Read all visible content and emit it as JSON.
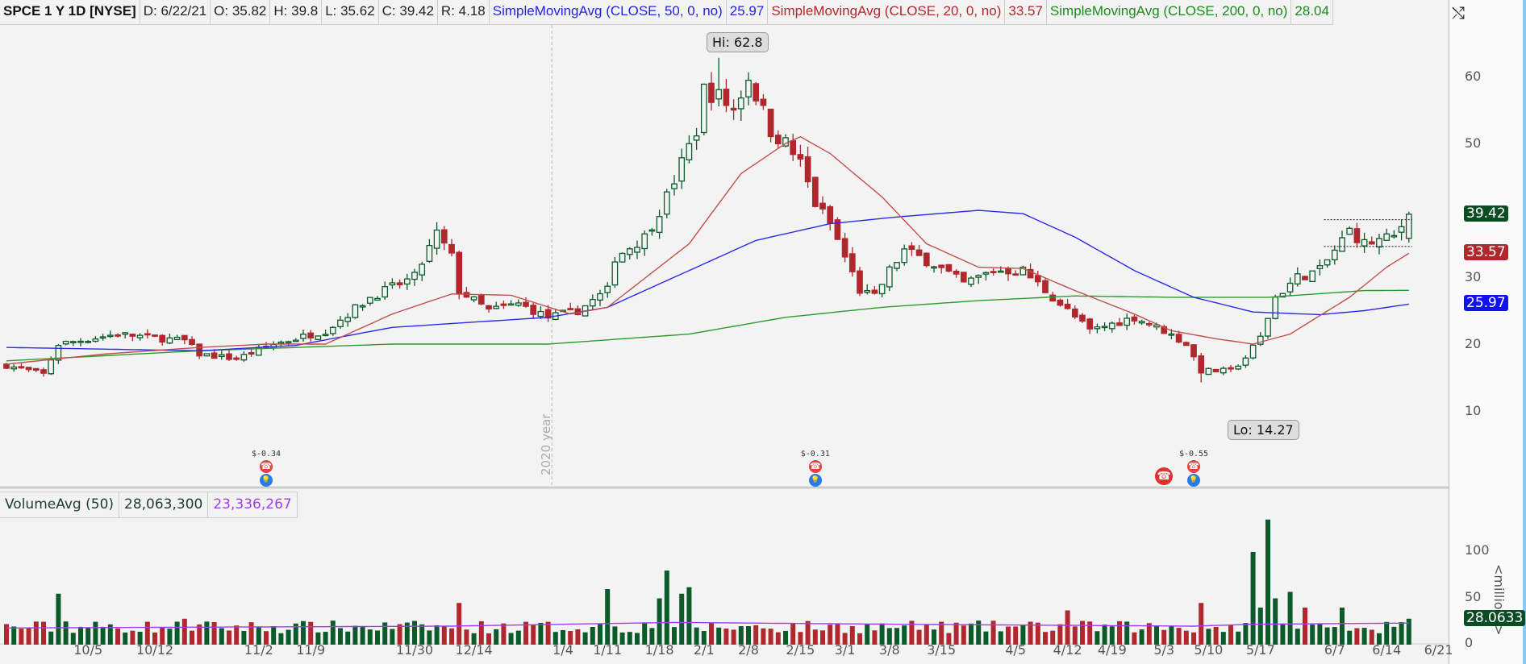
{
  "header": {
    "symbol": "SPCE 1 Y 1D [NYSE]",
    "date": "D: 6/22/21",
    "open": "O: 35.82",
    "high": "H: 39.8",
    "low": "L: 35.62",
    "close": "C: 39.42",
    "range": "R: 4.18",
    "sma50_label": "SimpleMovingAvg (CLOSE, 50, 0, no)",
    "sma50_value": "25.97",
    "sma20_label": "SimpleMovingAvg (CLOSE, 20, 0, no)",
    "sma20_value": "33.57",
    "sma200_label": "SimpleMovingAvg (CLOSE, 200, 0, no)",
    "sma200_value": "28.04",
    "toggle_icon": "toggle-panels-icon"
  },
  "volume_header": {
    "label": "VolumeAvg (50)",
    "volume": "28,063,300",
    "avg": "23,336,267"
  },
  "colors": {
    "up": "#0b5a2a",
    "down": "#b0282d",
    "sma50": "#2a2ae8",
    "sma20": "#c0504d",
    "sma200": "#2e9a2e",
    "volavg": "#a23cf0"
  },
  "chart_data": {
    "type": "candlestick",
    "title": "SPCE 1 Y 1D [NYSE]",
    "ylim": [
      5,
      67
    ],
    "y_ticks": [
      "60",
      "50",
      "30",
      "20",
      "10"
    ],
    "y_tick_values": [
      60,
      50,
      30,
      20,
      10
    ],
    "bars": 190,
    "close_path": [
      [
        0,
        16.8
      ],
      [
        5,
        15.5
      ],
      [
        7,
        20
      ],
      [
        15,
        21.5
      ],
      [
        24,
        20.5
      ],
      [
        26,
        18.5
      ],
      [
        31,
        17.8
      ],
      [
        36,
        20
      ],
      [
        43,
        22
      ],
      [
        49,
        27
      ],
      [
        55,
        30
      ],
      [
        58,
        36.5
      ],
      [
        60,
        33
      ],
      [
        61,
        28
      ],
      [
        65,
        25
      ],
      [
        69,
        26
      ],
      [
        73,
        24
      ],
      [
        77,
        25
      ],
      [
        81,
        28
      ],
      [
        82,
        33
      ],
      [
        86,
        36
      ],
      [
        89,
        42
      ],
      [
        91,
        47
      ],
      [
        93,
        52
      ],
      [
        94,
        58
      ],
      [
        96,
        57
      ],
      [
        98,
        55
      ],
      [
        100,
        60
      ],
      [
        103,
        52
      ],
      [
        105,
        50
      ],
      [
        107,
        47
      ],
      [
        109,
        41
      ],
      [
        111,
        38
      ],
      [
        113,
        33
      ],
      [
        115,
        28
      ],
      [
        117,
        27
      ],
      [
        119,
        31
      ],
      [
        121,
        34
      ],
      [
        125,
        32
      ],
      [
        129,
        29
      ],
      [
        133,
        31
      ],
      [
        137,
        31
      ],
      [
        140,
        28
      ],
      [
        144,
        24
      ],
      [
        146,
        22
      ],
      [
        152,
        24
      ],
      [
        156,
        22
      ],
      [
        159,
        20
      ],
      [
        161,
        16
      ],
      [
        165,
        16
      ],
      [
        167,
        18
      ],
      [
        169,
        21
      ],
      [
        171,
        27
      ],
      [
        174,
        30
      ],
      [
        177,
        31
      ],
      [
        179,
        34
      ],
      [
        181,
        37
      ],
      [
        183,
        35
      ],
      [
        187,
        36
      ],
      [
        189,
        39.42
      ]
    ],
    "high": {
      "label": "Hi: 62.8",
      "value": 62.8,
      "bar": 96
    },
    "low": {
      "label": "Lo: 14.27",
      "value": 14.27,
      "bar": 161
    },
    "sma50": [
      [
        0,
        19.5
      ],
      [
        26,
        19
      ],
      [
        39,
        19.8
      ],
      [
        52,
        22.5
      ],
      [
        73,
        24
      ],
      [
        81,
        25.5
      ],
      [
        92,
        31
      ],
      [
        101,
        35.5
      ],
      [
        111,
        38
      ],
      [
        120,
        39
      ],
      [
        131,
        40
      ],
      [
        137,
        39.5
      ],
      [
        144,
        36
      ],
      [
        152,
        31
      ],
      [
        160,
        27
      ],
      [
        168,
        24.8
      ],
      [
        177,
        24.4
      ],
      [
        183,
        25
      ],
      [
        189,
        25.97
      ]
    ],
    "sma20": [
      [
        0,
        17
      ],
      [
        13,
        18.5
      ],
      [
        26,
        19.5
      ],
      [
        35,
        20
      ],
      [
        43,
        20
      ],
      [
        52,
        24.5
      ],
      [
        60,
        27.5
      ],
      [
        68,
        27.3
      ],
      [
        76,
        24.5
      ],
      [
        81,
        25.5
      ],
      [
        92,
        35
      ],
      [
        99,
        45.5
      ],
      [
        105,
        50
      ],
      [
        107,
        51
      ],
      [
        111,
        48.5
      ],
      [
        118,
        42
      ],
      [
        124,
        35
      ],
      [
        131,
        31.5
      ],
      [
        137,
        31.3
      ],
      [
        144,
        28
      ],
      [
        152,
        24.5
      ],
      [
        157,
        22
      ],
      [
        163,
        20.8
      ],
      [
        168,
        20
      ],
      [
        173,
        21.5
      ],
      [
        181,
        27
      ],
      [
        186,
        31.5
      ],
      [
        189,
        33.57
      ]
    ],
    "sma200": [
      [
        0,
        17.5
      ],
      [
        26,
        19
      ],
      [
        52,
        20
      ],
      [
        73,
        20
      ],
      [
        92,
        21.5
      ],
      [
        105,
        24
      ],
      [
        118,
        25.5
      ],
      [
        131,
        26.5
      ],
      [
        144,
        27.2
      ],
      [
        157,
        27
      ],
      [
        170,
        27
      ],
      [
        183,
        28
      ],
      [
        189,
        28.04
      ]
    ],
    "resistance_lines": [
      {
        "from": 178,
        "to": 189,
        "value": 38.6
      },
      {
        "from": 178,
        "to": 189,
        "value": 34.6
      }
    ],
    "year_marker": {
      "label": "2020 year",
      "bar": 73.5
    },
    "events": [
      {
        "bar": 35,
        "label": "$-0.34",
        "icons": [
          "earnings-phone",
          "dividend-bulb"
        ]
      },
      {
        "bar": 109,
        "label": "$-0.31",
        "icons": [
          "earnings-phone",
          "dividend-bulb"
        ]
      },
      {
        "bar": 156,
        "label": "",
        "icons": [
          "conference-call"
        ]
      },
      {
        "bar": 160,
        "label": "$-0.55",
        "icons": [
          "earnings-phone",
          "dividend-bulb"
        ]
      }
    ],
    "last_price_badges": [
      {
        "value": "39.42",
        "price": 39.42,
        "color": "#0b4d23"
      },
      {
        "value": "33.57",
        "price": 33.57,
        "color": "#b0282d"
      },
      {
        "value": "25.97",
        "price": 25.97,
        "color": "#1010f0"
      }
    ],
    "volume": {
      "unit_label": "<millions>",
      "y_ticks": [
        "100",
        "50",
        "0"
      ],
      "y_tick_values": [
        100,
        50,
        0
      ],
      "last_badge": "28.0633",
      "spikes": [
        [
          7,
          55
        ],
        [
          8,
          25
        ],
        [
          24,
          28
        ],
        [
          61,
          45
        ],
        [
          81,
          60
        ],
        [
          88,
          50
        ],
        [
          89,
          80
        ],
        [
          91,
          55
        ],
        [
          92,
          62
        ],
        [
          143,
          37
        ],
        [
          161,
          45
        ],
        [
          168,
          100
        ],
        [
          169,
          40
        ],
        [
          170,
          135
        ],
        [
          171,
          50
        ],
        [
          173,
          57
        ],
        [
          175,
          40
        ],
        [
          180,
          40
        ],
        [
          189,
          28
        ]
      ],
      "avg": [
        [
          0,
          18
        ],
        [
          60,
          20
        ],
        [
          90,
          24
        ],
        [
          120,
          22
        ],
        [
          160,
          20
        ],
        [
          168,
          22
        ],
        [
          189,
          23.3
        ]
      ]
    },
    "x_ticks": [
      {
        "label": "10/5",
        "bar": 11
      },
      {
        "label": "10/12",
        "bar": 20
      },
      {
        "label": "11/2",
        "bar": 34
      },
      {
        "label": "11/9",
        "bar": 41
      },
      {
        "label": "11/30",
        "bar": 55
      },
      {
        "label": "12/14",
        "bar": 63
      },
      {
        "label": "1/4",
        "bar": 75
      },
      {
        "label": "1/11",
        "bar": 81
      },
      {
        "label": "1/18",
        "bar": 88
      },
      {
        "label": "2/1",
        "bar": 94
      },
      {
        "label": "2/8",
        "bar": 100
      },
      {
        "label": "2/15",
        "bar": 107
      },
      {
        "label": "3/1",
        "bar": 113
      },
      {
        "label": "3/8",
        "bar": 119
      },
      {
        "label": "3/15",
        "bar": 126
      },
      {
        "label": "4/5",
        "bar": 136
      },
      {
        "label": "4/12",
        "bar": 143
      },
      {
        "label": "4/19",
        "bar": 149
      },
      {
        "label": "5/3",
        "bar": 156
      },
      {
        "label": "5/10",
        "bar": 162
      },
      {
        "label": "5/17",
        "bar": 169
      },
      {
        "label": "6/7",
        "bar": 179
      },
      {
        "label": "6/14",
        "bar": 186
      },
      {
        "label": "6/21",
        "bar": 193
      }
    ]
  }
}
